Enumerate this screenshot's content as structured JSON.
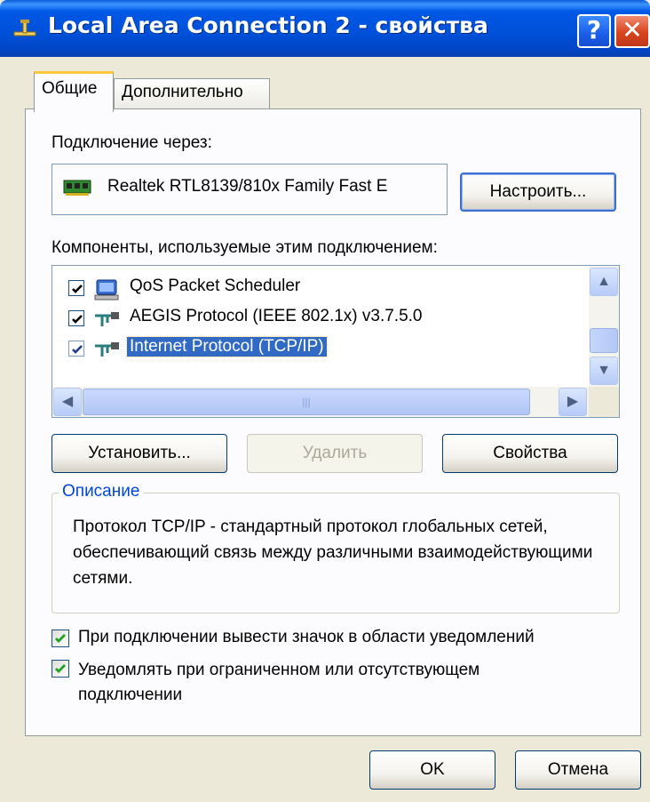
{
  "window": {
    "title": "Local Area Connection 2 - свойства",
    "help_glyph": "?",
    "close_glyph": "✕"
  },
  "tabs": [
    {
      "label": "Общие",
      "active": true
    },
    {
      "label": "Дополнительно",
      "active": false
    }
  ],
  "connect_via": {
    "label": "Подключение через:",
    "adapter": "Realtek RTL8139/810x Family Fast E",
    "configure_button": "Настроить..."
  },
  "components": {
    "label": "Компоненты, используемые этим подключением:",
    "items": [
      {
        "label": "QoS Packet Scheduler",
        "checked": true,
        "selected": false,
        "icon": "scheduler-icon"
      },
      {
        "label": "AEGIS Protocol (IEEE 802.1x) v3.7.5.0",
        "checked": true,
        "selected": false,
        "icon": "protocol-icon"
      },
      {
        "label": "Internet Protocol (TCP/IP)",
        "checked": true,
        "selected": true,
        "icon": "protocol-icon"
      }
    ]
  },
  "buttons": {
    "install": "Установить...",
    "remove": "Удалить",
    "properties": "Свойства"
  },
  "description": {
    "title": "Описание",
    "text": "Протокол TCP/IP - стандартный протокол глобальных сетей, обеспечивающий связь между различными взаимодействующими сетями."
  },
  "options": {
    "show_icon": {
      "label": "При подключении вывести значок в области уведомлений",
      "checked": true
    },
    "notify_limited": {
      "label": "Уведомлять при ограниченном или отсутствующем подключении",
      "checked": true
    }
  },
  "footer": {
    "ok": "OK",
    "cancel": "Отмена"
  },
  "colors": {
    "titlebar": "#0058e6",
    "selection": "#316ac5",
    "group_title": "#0046d5",
    "check": "#21a121"
  }
}
